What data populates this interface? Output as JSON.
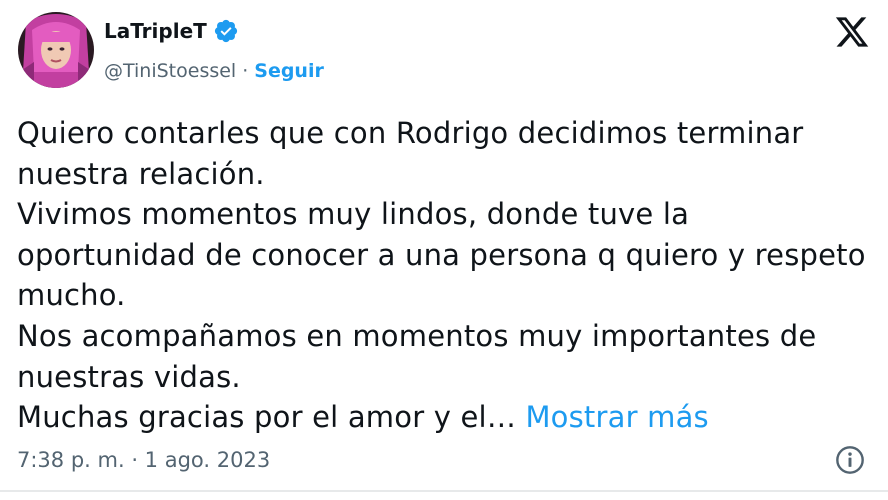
{
  "author": {
    "display_name": "LaTripleT",
    "handle": "@TiniStoessel",
    "separator": "·",
    "follow_label": "Seguir",
    "verified_icon": "verified-badge-icon",
    "verified_color": "#1d9bf0"
  },
  "platform_icon": "x-logo-icon",
  "tweet": {
    "lines": [
      "Quiero contarles que con Rodrigo decidimos terminar",
      "nuestra relación.",
      "Vivimos momentos muy lindos, donde tuve la",
      "oportunidad de conocer a una persona q quiero y respeto",
      "mucho.",
      "Nos acompañamos en momentos muy importantes de",
      "nuestras vidas.",
      "Muchas gracias por el amor y el…"
    ],
    "show_more_label": "Mostrar más",
    "link_color": "#1d9bf0"
  },
  "meta": {
    "timestamp": "7:38 p. m. · 1 ago. 2023",
    "info_icon": "info-icon"
  }
}
